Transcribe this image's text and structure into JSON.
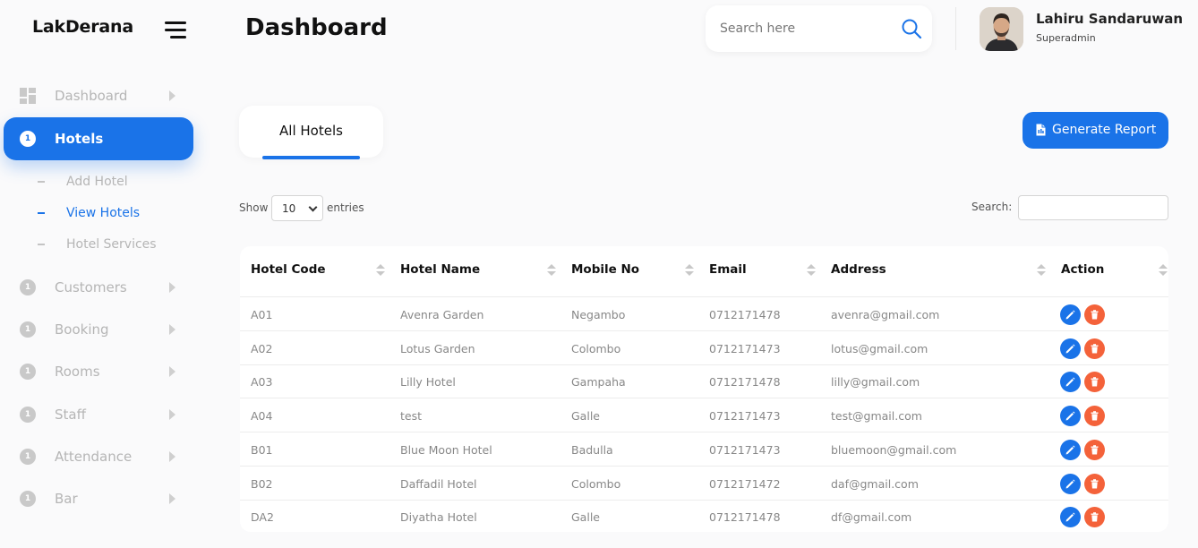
{
  "sidebar": {
    "brand": "LakDerana",
    "items": [
      {
        "label": "Dashboard"
      },
      {
        "label": "Hotels",
        "icon_text": "1"
      },
      {
        "label": "Customers",
        "icon_text": "1"
      },
      {
        "label": "Booking",
        "icon_text": "1"
      },
      {
        "label": "Rooms",
        "icon_text": "1"
      },
      {
        "label": "Staff",
        "icon_text": "1"
      },
      {
        "label": "Attendance",
        "icon_text": "1"
      },
      {
        "label": "Bar",
        "icon_text": "1"
      }
    ],
    "hotel_subitems": [
      {
        "label": "Add Hotel"
      },
      {
        "label": "View Hotels"
      },
      {
        "label": "Hotel Services"
      }
    ]
  },
  "header": {
    "title": "Dashboard",
    "search_placeholder": "Search here",
    "user_name": "Lahiru Sandaruwan",
    "user_role": "Superadmin"
  },
  "main": {
    "tab_label": "All Hotels",
    "report_button": "Generate Report",
    "show_label": "Show",
    "entries_value": "10",
    "entries_label": "entries",
    "search_label": "Search:",
    "columns": [
      "Hotel Code",
      "Hotel Name",
      "Mobile No",
      "Email",
      "Address",
      "Action"
    ],
    "rows": [
      [
        "A01",
        "Avenra Garden",
        "Negambo",
        "0712171478",
        "avenra@gmail.com"
      ],
      [
        "A02",
        "Lotus Garden",
        "Colombo",
        "0712171473",
        "lotus@gmail.com"
      ],
      [
        "A03",
        "Lilly Hotel",
        "Gampaha",
        "0712171478",
        "lilly@gmail.com"
      ],
      [
        "A04",
        "test",
        "Galle",
        "0712171473",
        "test@gmail.com"
      ],
      [
        "B01",
        "Blue Moon Hotel",
        "Badulla",
        "0712171473",
        "bluemoon@gmail.com"
      ],
      [
        "B02",
        "Daffadil Hotel",
        "Colombo",
        "0712171472",
        "daf@gmail.com"
      ],
      [
        "DA2",
        "Diyatha Hotel",
        "Galle",
        "0712171478",
        "df@gmail.com"
      ]
    ]
  },
  "colors": {
    "accent": "#1a73e8",
    "delete": "#f4623a",
    "muted_text": "#b5b5b5"
  }
}
